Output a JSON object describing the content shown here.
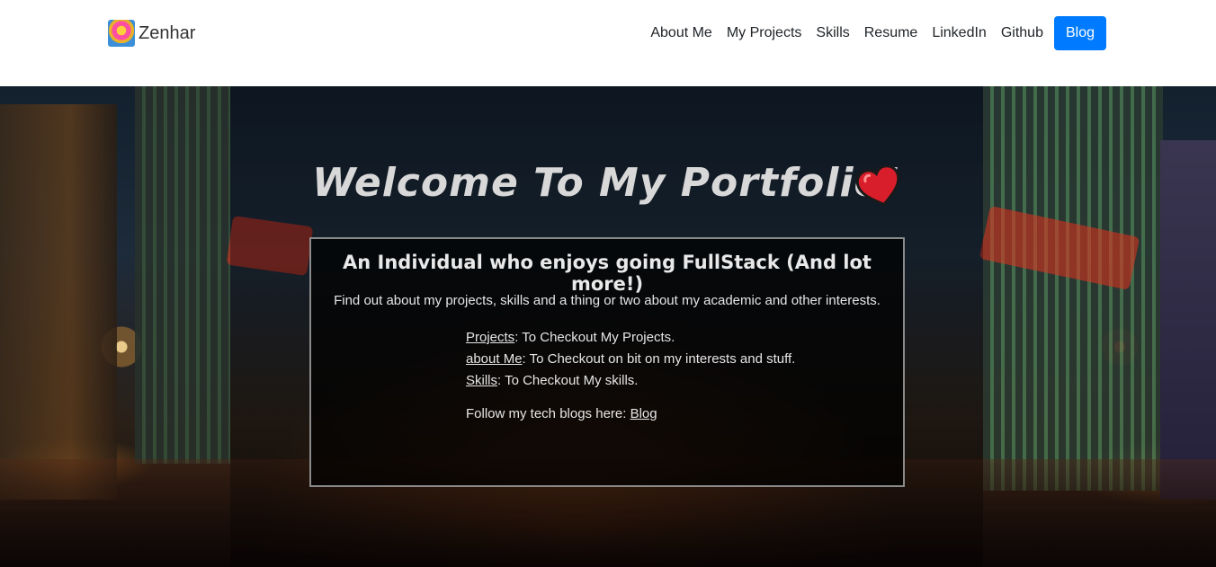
{
  "brand": {
    "name": "Zenhar",
    "logo_icon": "colorful-avatar-logo"
  },
  "nav": {
    "links": [
      "About Me",
      "My Projects",
      "Skills",
      "Resume",
      "LinkedIn",
      "Github"
    ],
    "blog_button": "Blog",
    "blog_color": "#007bff"
  },
  "hero": {
    "title": "Welcome To My Portfolio!",
    "heart_icon": "heart-icon",
    "card": {
      "heading": "An Individual who enjoys going FullStack (And lot more!)",
      "subtitle": "Find out about my projects, skills and a thing or two about my academic and other interests.",
      "items": [
        {
          "link": "Projects",
          "text": ": To Checkout My Projects."
        },
        {
          "link": "about Me",
          "text": ": To Checkout on bit on my interests and stuff."
        },
        {
          "link": "Skills",
          "text": ": To Checkout My skills."
        }
      ],
      "blog_prefix": "Follow my tech blogs here: ",
      "blog_link": "Blog"
    }
  }
}
